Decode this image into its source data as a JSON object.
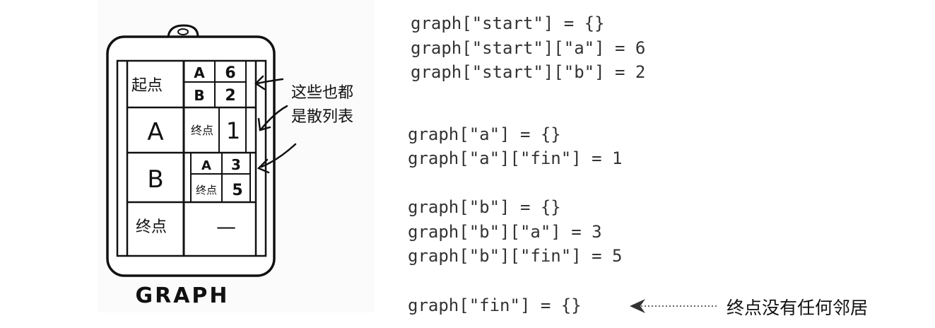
{
  "illustration": {
    "title": "GRAPH",
    "rows": [
      {
        "label": "起点",
        "entries": [
          {
            "key": "A",
            "value": "6"
          },
          {
            "key": "B",
            "value": "2"
          }
        ]
      },
      {
        "label": "A",
        "entries": [
          {
            "key": "终点",
            "value": "1"
          }
        ]
      },
      {
        "label": "B",
        "entries": [
          {
            "key": "A",
            "value": "3"
          },
          {
            "key": "终点",
            "value": "5"
          }
        ]
      },
      {
        "label": "终点",
        "empty_mark": "—"
      }
    ],
    "side_note_line1": "这些也都",
    "side_note_line2": "是散列表"
  },
  "code": [
    "graph[\"start\"] = {}",
    "graph[\"start\"][\"a\"] = 6",
    "graph[\"start\"][\"b\"] = 2",
    "graph[\"a\"] = {}",
    "graph[\"a\"][\"fin\"] = 1",
    "graph[\"b\"] = {}",
    "graph[\"b\"][\"a\"] = 3",
    "graph[\"b\"][\"fin\"] = 5",
    "graph[\"fin\"] = {}"
  ],
  "fin_note": "终点没有任何邻居"
}
